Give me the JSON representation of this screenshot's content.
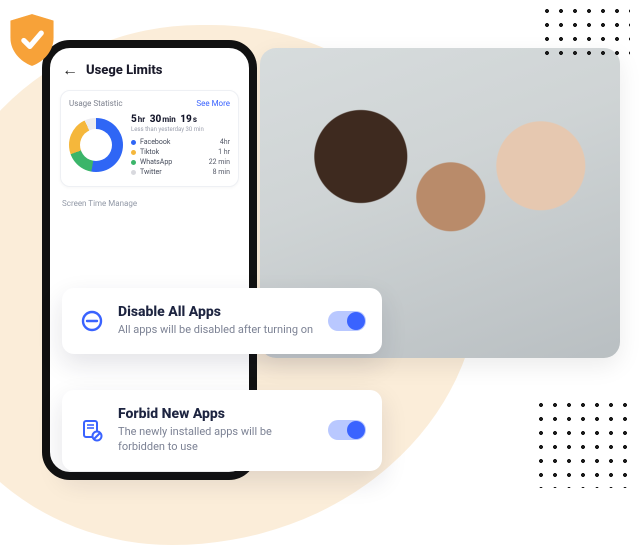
{
  "badge": {
    "icon": "shield-check"
  },
  "screen": {
    "title": "Usege Limits",
    "stat": {
      "heading": "Usage Statistic",
      "see_more": "See More",
      "total": {
        "h_val": "5",
        "h_unit": "hr",
        "m_val": "30",
        "m_unit": "min",
        "s_val": "19",
        "s_unit": "s"
      },
      "delta": "Less than yesterday 30 min",
      "apps": [
        {
          "name": "Facebook",
          "time": "4hr",
          "color": "#2f66f5"
        },
        {
          "name": "Tiktok",
          "time": "1 hr",
          "color": "#f5b73b"
        },
        {
          "name": "WhatsApp",
          "time": "22 min",
          "color": "#3bb56a"
        },
        {
          "name": "Twitter",
          "time": "8 min",
          "color": "#d8d9de"
        }
      ]
    },
    "manage_label": "Screen Time Manage"
  },
  "options": {
    "disable": {
      "title": "Disable All Apps",
      "desc": "All apps will be disabled after turning on",
      "on": true
    },
    "forbid": {
      "title": "Forbid New Apps",
      "desc": "The newly installed apps will be forbidden to use",
      "on": true
    }
  },
  "chart_data": {
    "type": "pie",
    "title": "Usage Statistic",
    "categories": [
      "Facebook",
      "Tiktok",
      "WhatsApp",
      "Twitter"
    ],
    "values": [
      240,
      60,
      22,
      8
    ],
    "unit": "minutes",
    "total_label": "5hr 30min 19s",
    "colors": [
      "#2f66f5",
      "#f5b73b",
      "#3bb56a",
      "#d8d9de"
    ]
  }
}
